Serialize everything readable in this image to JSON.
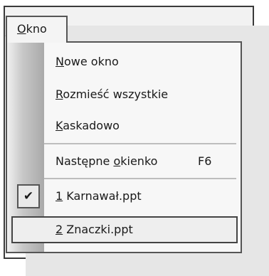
{
  "menu": {
    "title_mnemonic": "O",
    "title_rest": "kno"
  },
  "items": [
    {
      "mnemonic": "N",
      "rest": "owe okno"
    },
    {
      "mnemonic": "R",
      "rest": "ozmieść wszystkie"
    },
    {
      "mnemonic": "K",
      "rest": "askadowo"
    },
    {
      "before": "Następne ",
      "mnemonic": "o",
      "rest": "kienko",
      "shortcut": "F6"
    },
    {
      "mnemonic": "1",
      "rest": " Karnawał.ppt",
      "checked": true
    },
    {
      "mnemonic": "2",
      "rest": " Znaczki.ppt",
      "highlighted": true
    }
  ],
  "icons": {
    "check": "✔"
  }
}
